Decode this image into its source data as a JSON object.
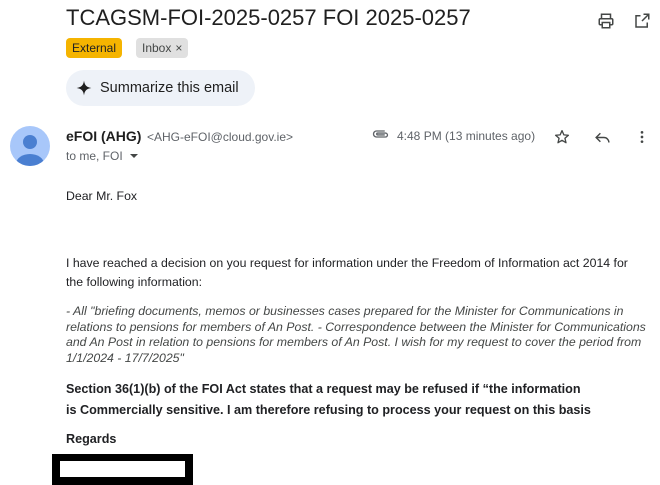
{
  "email": {
    "subject": "TCAGSM-FOI-2025-0257 FOI 2025-0257",
    "labels": {
      "external": "External",
      "inbox": "Inbox",
      "inbox_remove": "×"
    },
    "summarize_label": "Summarize this email",
    "sender_name": "eFOI (AHG)",
    "sender_email": "<AHG-eFOI@cloud.gov.ie>",
    "recipients": "to me, FOI",
    "timestamp": "4:48 PM (13 minutes ago)",
    "greeting": "Dear Mr. Fox",
    "intro": "I have reached a decision on you request for information under the Freedom of Information act 2014 for the following information:",
    "quote": "- All \"briefing documents, memos or businesses cases prepared for the Minister for Communications in relations to pensions for members of An Post. - Correspondence between the Minister for Communications and An Post in relation to pensions for members of An Post. I wish for my request to cover the period from 1/1/2024 - 17/7/2025\"",
    "section_line1": "Section 36(1)(b) of the FOI Act states that a request may be refused if “the information",
    "section_line2": "is Commercially sensitive. I am therefore refusing to process your request on this basis",
    "regards": "Regards"
  },
  "colors": {
    "label_external": "#f5b400",
    "label_inbox": "#e0e0e0",
    "summarize_bg": "#eef2f8",
    "avatar_bg": "#a8c7fa",
    "avatar_fg": "#4a7fd1"
  },
  "icons": {
    "print": "printer-icon",
    "popout": "open-in-new-window-icon",
    "sparkle": "sparkle-icon",
    "attachment": "paperclip-icon",
    "star": "star-icon",
    "reply": "reply-icon",
    "more": "more-vertical-icon",
    "recipients_toggle": "chevron-down-icon"
  }
}
